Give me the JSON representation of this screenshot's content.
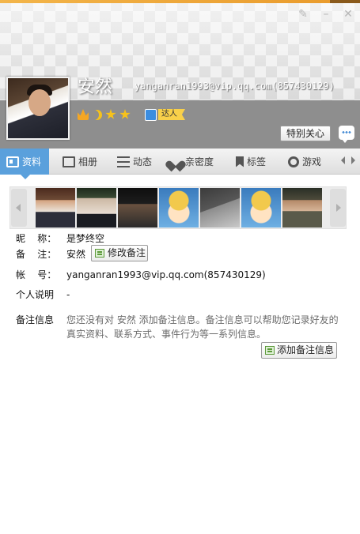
{
  "header": {
    "display_name": "安然",
    "account": "yanganran1993@vip.qq.com(857430129)",
    "badge_tag": "达人",
    "special_care_label": "特别关心",
    "window_controls": [
      "skin-icon",
      "minimize-icon",
      "close-icon"
    ]
  },
  "tabs": [
    {
      "label": "资料",
      "icon": "profile-card-icon",
      "active": true
    },
    {
      "label": "相册",
      "icon": "album-icon"
    },
    {
      "label": "动态",
      "icon": "feed-list-icon"
    },
    {
      "label": "亲密度",
      "icon": "heart-icon"
    },
    {
      "label": "标签",
      "icon": "bookmark-icon"
    },
    {
      "label": "游戏",
      "icon": "game-icon"
    }
  ],
  "profile": {
    "nickname_label": "昵    称：",
    "nickname": "是梦终空",
    "remark_label": "备    注：",
    "remark": "安然",
    "edit_remark_button": "修改备注",
    "account_label": "帐    号：",
    "account": "yanganran1993@vip.qq.com(857430129)",
    "bio_label": "个人说明",
    "bio": "-",
    "remark_info_label": "备注信息",
    "remark_info_text": "您还没有对 安然 添加备注信息。备注信息可以帮助您记录好友的真实资料、联系方式、事件行为等一系列信息。",
    "add_remark_button": "添加备注信息"
  },
  "colors": {
    "accent": "#5aa0dc",
    "header_band": "#8e8e8e",
    "level_gold": "#f7c21a"
  }
}
